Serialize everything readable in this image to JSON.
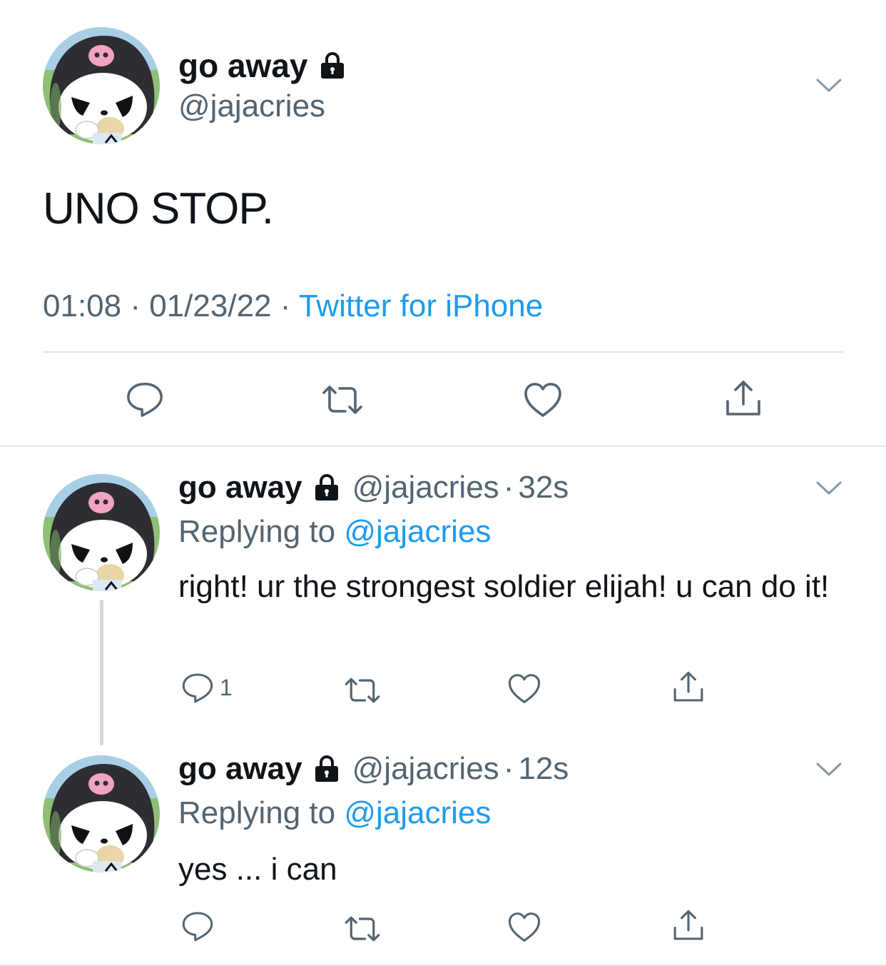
{
  "main_tweet": {
    "display_name": "go away",
    "handle": "@jajacries",
    "text": "UNO STOP.",
    "time": "01:08",
    "date": "01/23/22",
    "separator": "·",
    "source": "Twitter for iPhone",
    "icons": {
      "lock": "lock-icon",
      "menu": "chevron-down-icon",
      "reply": "reply-icon",
      "retweet": "retweet-icon",
      "like": "heart-icon",
      "share": "share-icon"
    }
  },
  "replies": [
    {
      "display_name": "go away",
      "handle": "@jajacries",
      "dot": "·",
      "time": "32s",
      "replying_prefix": "Replying to ",
      "replying_to": "@jajacries",
      "text": "right! ur the strongest soldier elijah! u can do it!",
      "reply_count": "1"
    },
    {
      "display_name": "go away",
      "handle": "@jajacries",
      "dot": "·",
      "time": "12s",
      "replying_prefix": "Replying to ",
      "replying_to": "@jajacries",
      "text": "yes ... i can",
      "reply_count": ""
    }
  ],
  "colors": {
    "text": "#0f1419",
    "secondary": "#536471",
    "link": "#1d9bf0",
    "divider": "#e1e6ea",
    "thread_line": "#cfd9de"
  }
}
